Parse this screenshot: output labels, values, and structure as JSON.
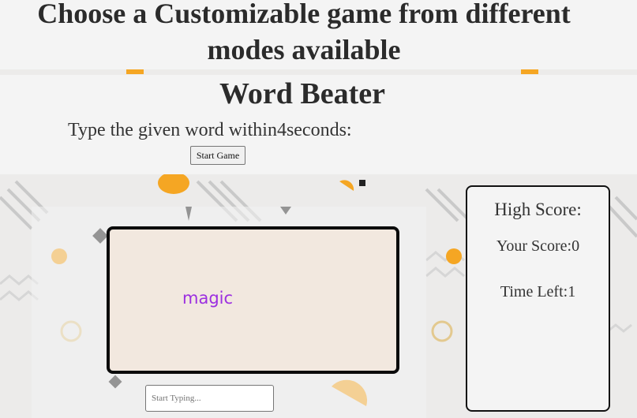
{
  "page": {
    "heading": "Choose a Customizable game from different modes available"
  },
  "game": {
    "title": "Word Beater",
    "instruction_prefix": "Type the given word within",
    "seconds": "4",
    "instruction_suffix": "seconds:",
    "start_button_label": "Start Game"
  },
  "word_display": {
    "current_word": "magic",
    "word_color": "#9c2fe0"
  },
  "input": {
    "placeholder": "Start Typing...",
    "value": ""
  },
  "score_panel": {
    "high_score_label": "High Score:",
    "high_score_value": "",
    "score_label": "Your Score:",
    "score_value": "0",
    "time_label": "Time Left:",
    "time_value": "1"
  },
  "theme": {
    "accent": "#f5a623",
    "border": "#0b0b0b"
  }
}
